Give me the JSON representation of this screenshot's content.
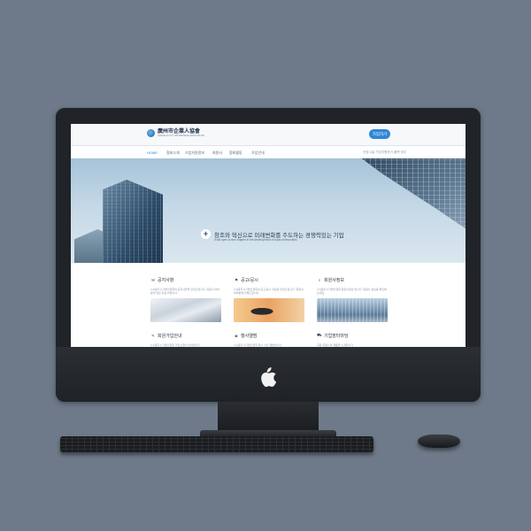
{
  "header": {
    "logo_text": "광주시 기업인협회",
    "logo_hanja": "廣州市企業人協會",
    "logo_sub": "GWANGJU CITY ENTERPRISE ASSOCIATION",
    "join_button": "가입하기"
  },
  "nav": {
    "items": [
      "HOME",
      "협회소개",
      "기업지원정보",
      "회원사",
      "협회활동",
      "가입안내"
    ],
    "active_index": 0,
    "right_text": "산업시설 기업지원하기 플랫 광주"
  },
  "hero": {
    "title": "창조와 혁신으로 미래변화를 주도하는 경쟁력있는 기업",
    "subtitle": "It will open a new chapter in the development of local communities"
  },
  "cards": [
    {
      "icon": "speech-bubbles-icon",
      "title": "공지사항",
      "text": "(사)광주시기업인협회의 공지사항을 안내드립니다. 회원사 여러분의 많은 관심 바랍니다.",
      "image": "documents-photo"
    },
    {
      "icon": "flag-icon",
      "title": "공고/공시",
      "text": "(사)광주시기업인협회의 공고/공시 자료를 안내드립니다. 회원사 여러분께 전해드립니다.",
      "image": "microphone-photo"
    },
    {
      "icon": "search-icon",
      "title": "회원사정보",
      "text": "(사)광주시기업인협회 회원사정보 입니다. 회원사 정보를 확인해 보세요.",
      "image": "building-photo"
    },
    {
      "icon": "pencil-icon",
      "title": "회원가입안내",
      "text": "(사)광주시기업인협회 가입신청서 안내입니다.",
      "image": ""
    },
    {
      "icon": "camera-icon",
      "title": "행사앨범",
      "text": "(사)광주시기업인협회 행사 사진 앨범입니다.",
      "image": ""
    },
    {
      "icon": "cart-icon",
      "title": "기업장터마당",
      "text": "회원 회원사의 제품을 소개합니다.",
      "image": ""
    }
  ]
}
